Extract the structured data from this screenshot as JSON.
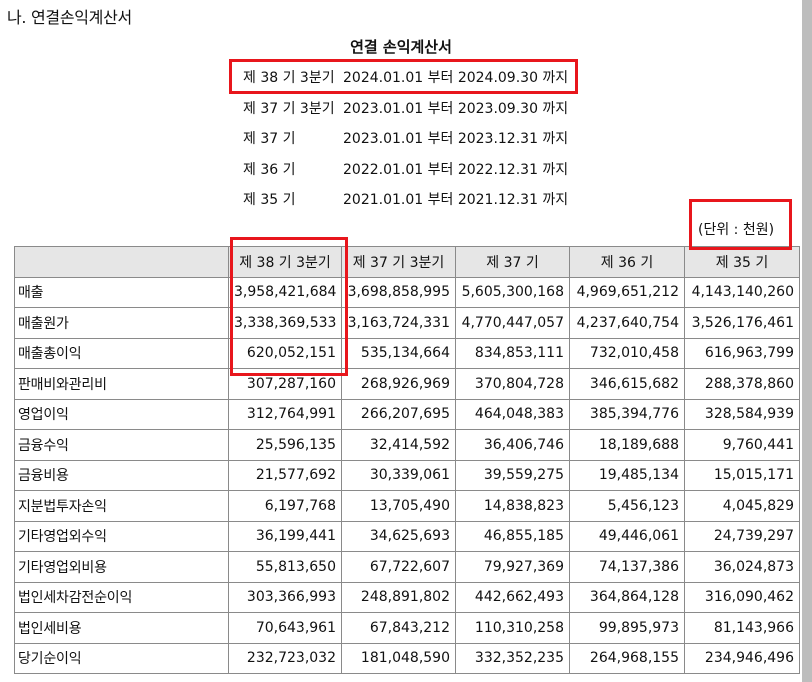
{
  "section_title": "나. 연결손익계산서",
  "doc_title": "연결 손익계산서",
  "periods": [
    {
      "seq": "제 38 기 3분기",
      "range": "2024.01.01 부터 2024.09.30 까지"
    },
    {
      "seq": "제 37 기 3분기",
      "range": "2023.01.01 부터 2023.09.30 까지"
    },
    {
      "seq": "제 37 기",
      "range": "2023.01.01 부터 2023.12.31 까지"
    },
    {
      "seq": "제 36 기",
      "range": "2022.01.01 부터 2022.12.31 까지"
    },
    {
      "seq": "제 35 기",
      "range": "2021.01.01 부터 2021.12.31 까지"
    }
  ],
  "unit": "(단위 : 천원)",
  "table": {
    "headers": [
      "",
      "제 38 기 3분기",
      "제 37 기 3분기",
      "제 37 기",
      "제 36 기",
      "제 35 기"
    ],
    "rows": [
      {
        "label": "매출",
        "values": [
          "3,958,421,684",
          "3,698,858,995",
          "5,605,300,168",
          "4,969,651,212",
          "4,143,140,260"
        ]
      },
      {
        "label": "매출원가",
        "values": [
          "3,338,369,533",
          "3,163,724,331",
          "4,770,447,057",
          "4,237,640,754",
          "3,526,176,461"
        ]
      },
      {
        "label": "매출총이익",
        "values": [
          "620,052,151",
          "535,134,664",
          "834,853,111",
          "732,010,458",
          "616,963,799"
        ]
      },
      {
        "label": "판매비와관리비",
        "values": [
          "307,287,160",
          "268,926,969",
          "370,804,728",
          "346,615,682",
          "288,378,860"
        ]
      },
      {
        "label": "영업이익",
        "values": [
          "312,764,991",
          "266,207,695",
          "464,048,383",
          "385,394,776",
          "328,584,939"
        ]
      },
      {
        "label": "금융수익",
        "values": [
          "25,596,135",
          "32,414,592",
          "36,406,746",
          "18,189,688",
          "9,760,441"
        ]
      },
      {
        "label": "금융비용",
        "values": [
          "21,577,692",
          "30,339,061",
          "39,559,275",
          "19,485,134",
          "15,015,171"
        ]
      },
      {
        "label": "지분법투자손익",
        "values": [
          "6,197,768",
          "13,705,490",
          "14,838,823",
          "5,456,123",
          "4,045,829"
        ]
      },
      {
        "label": "기타영업외수익",
        "values": [
          "36,199,441",
          "34,625,693",
          "46,855,185",
          "49,446,061",
          "24,739,297"
        ]
      },
      {
        "label": "기타영업외비용",
        "values": [
          "55,813,650",
          "67,722,607",
          "79,927,369",
          "74,137,386",
          "36,024,873"
        ]
      },
      {
        "label": "법인세차감전순이익",
        "values": [
          "303,366,993",
          "248,891,802",
          "442,662,493",
          "364,864,128",
          "316,090,462"
        ]
      },
      {
        "label": "법인세비용",
        "values": [
          "70,643,961",
          "67,843,212",
          "110,310,258",
          "99,895,973",
          "81,143,966"
        ]
      },
      {
        "label": "당기순이익",
        "values": [
          "232,723,032",
          "181,048,590",
          "332,352,235",
          "264,968,155",
          "234,946,496"
        ]
      }
    ]
  }
}
